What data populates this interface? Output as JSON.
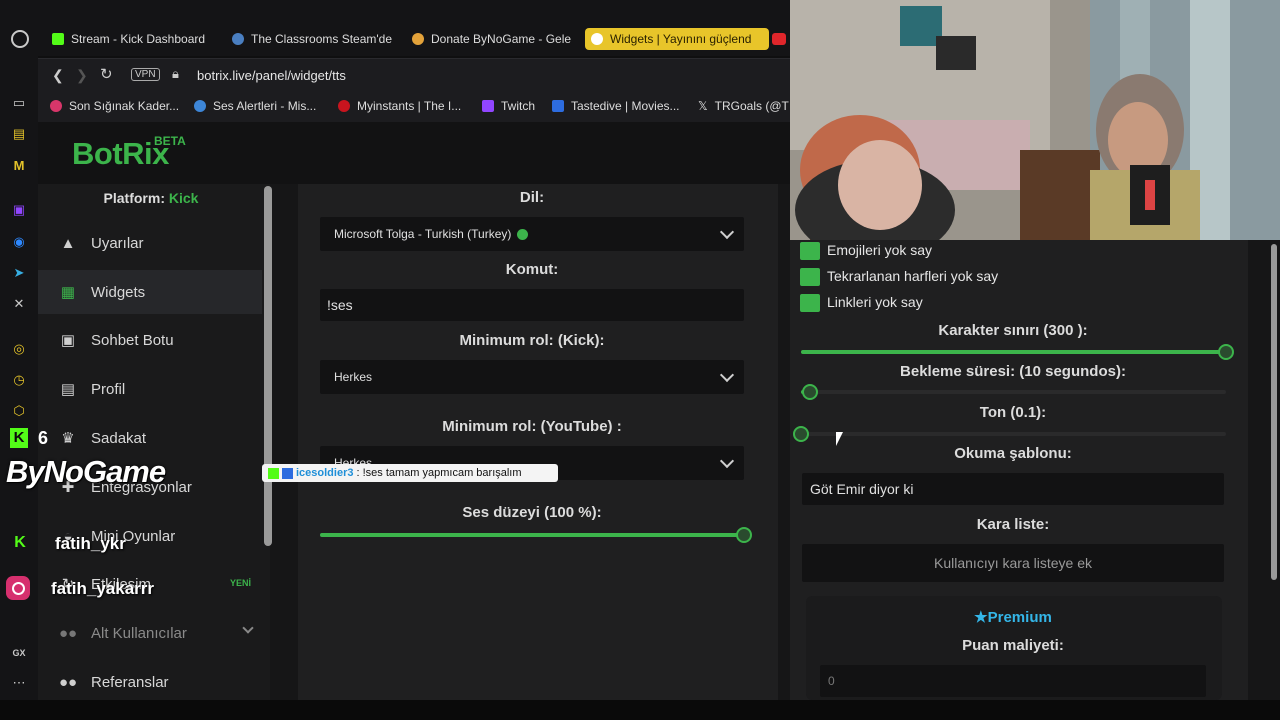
{
  "browser": {
    "tabs": [
      {
        "label": "Stream - Kick Dashboard",
        "icon": "kick-icon"
      },
      {
        "label": "The Classrooms Steam'de",
        "icon": "steam-icon"
      },
      {
        "label": "Donate ByNoGame - Gele",
        "icon": "donate-icon"
      },
      {
        "label": "Widgets | Yayınını güçlend",
        "icon": "botrix-icon",
        "active": true
      }
    ],
    "vpn_label": "VPN",
    "url": "botrix.live/panel/widget/tts",
    "bookmarks": [
      {
        "label": "Son Sığınak Kader..."
      },
      {
        "label": "Ses Alertleri - Mis..."
      },
      {
        "label": "Myinstants | The I..."
      },
      {
        "label": "Twitch"
      },
      {
        "label": "Tastedive | Movies..."
      },
      {
        "label": "TRGoals (@T"
      }
    ]
  },
  "brand": {
    "name": "BotRix",
    "badge": "BETA"
  },
  "sidebar": {
    "platform_label": "Platform:",
    "platform_value": "Kick",
    "items": [
      {
        "label": "Uyarılar",
        "icon": "warning-icon"
      },
      {
        "label": "Widgets",
        "icon": "widgets-icon",
        "active": true
      },
      {
        "label": "Sohbet Botu",
        "icon": "robot-icon"
      },
      {
        "label": "Profil",
        "icon": "profile-card-icon"
      },
      {
        "label": "Sadakat",
        "icon": "trophy-icon"
      },
      {
        "label": "Entegrasyonlar",
        "icon": "puzzle-icon"
      },
      {
        "label": "Mini Oyunlar",
        "icon": "gamepad-icon"
      },
      {
        "label": "Etkileşim",
        "icon": "interaction-icon",
        "badge": "YENİ"
      },
      {
        "label": "Alt Kullanıcılar",
        "icon": "users-icon"
      },
      {
        "label": "Referanslar",
        "icon": "referral-icon"
      }
    ]
  },
  "center": {
    "lang_label": "Dil:",
    "lang_value": "Microsoft Tolga - Turkish (Turkey)",
    "command_label": "Komut:",
    "command_value": "!ses",
    "minrole_kick_label": "Minimum rol: (Kick):",
    "minrole_kick_value": "Herkes",
    "minrole_yt_label": "Minimum rol: (YouTube) :",
    "minrole_yt_value": "Herkes",
    "volume_label": "Ses düzeyi (100 %):",
    "volume_fraction": 1.0
  },
  "right": {
    "checkboxes": [
      {
        "label": "Emojileri yok say",
        "checked": true
      },
      {
        "label": "Tekrarlanan harfleri yok say",
        "checked": true
      },
      {
        "label": "Linkleri yok say",
        "checked": true
      }
    ],
    "charlimit_label": "Karakter sınırı (300 ):",
    "charlimit_fraction": 1.0,
    "cooldown_label": "Bekleme süresi: (10 segundos):",
    "cooldown_fraction": 0.02,
    "tone_label": "Ton (0.1):",
    "tone_fraction": 0.0,
    "template_label": "Okuma şablonu:",
    "template_value": "Göt Emir diyor ki",
    "blacklist_label": "Kara liste:",
    "blacklist_placeholder": "Kullanıcıyı kara listeye ek",
    "premium_label": "Premium",
    "cost_label": "Puan maliyeti:",
    "cost_value": "0"
  },
  "overlay": {
    "counter": "6",
    "brand_text": "ByNoGame",
    "chat_user": "icesoldier3",
    "chat_text": ": !ses tamam yapmıcam barışalım",
    "kick_handle": "fatih_ykr",
    "insta_handle": "fatih_yakarrr"
  },
  "colors": {
    "accent_green": "#3cb44b",
    "kick_green": "#53fc18",
    "tab_active": "#e8c52a"
  }
}
